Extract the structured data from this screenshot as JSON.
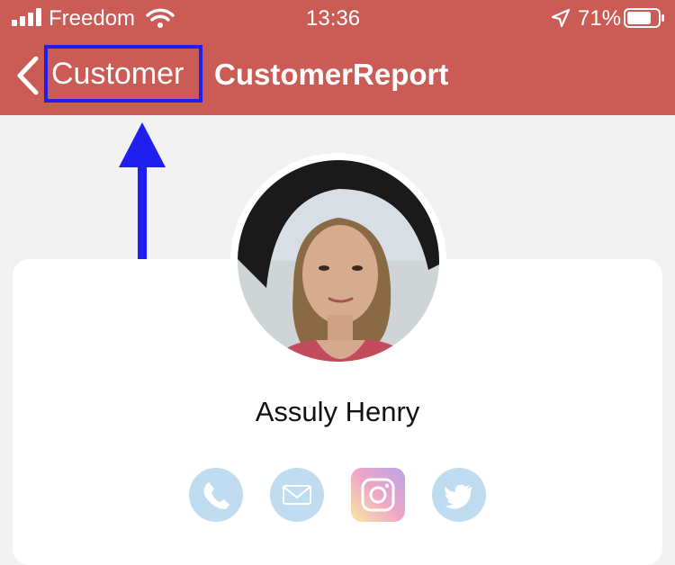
{
  "status_bar": {
    "carrier": "Freedom",
    "time": "13:36",
    "battery_percent": "71%"
  },
  "nav": {
    "back_label": "Customer",
    "title": "CustomerReport"
  },
  "profile": {
    "name": "Assuly Henry"
  },
  "social": {
    "icons": [
      "phone-icon",
      "email-icon",
      "instagram-icon",
      "twitter-icon"
    ]
  },
  "colors": {
    "nav_background": "#cb5b55",
    "highlight_box": "#1f1ff0",
    "page_background": "#f2f2f2"
  }
}
